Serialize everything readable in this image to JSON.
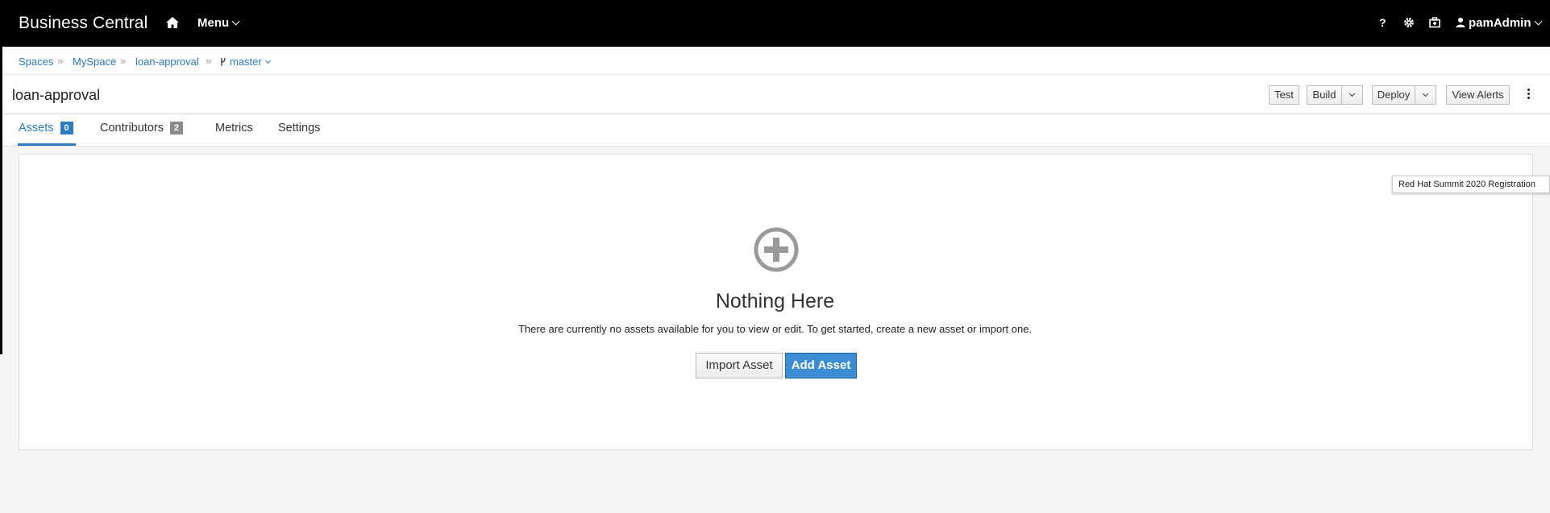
{
  "topbar": {
    "brand": "Business Central",
    "menu_label": "Menu",
    "help_label": "?",
    "user_label": "pamAdmin"
  },
  "breadcrumb": {
    "items": [
      "Spaces",
      "MySpace",
      "loan-approval"
    ],
    "branch": "master",
    "separator": "»"
  },
  "header": {
    "title": "loan-approval",
    "buttons": {
      "test": "Test",
      "build": "Build",
      "deploy": "Deploy",
      "view_alerts": "View Alerts"
    }
  },
  "tabs": [
    {
      "label": "Assets",
      "badge": "0",
      "active": true
    },
    {
      "label": "Contributors",
      "badge": "2",
      "active": false
    },
    {
      "label": "Metrics",
      "active": false
    },
    {
      "label": "Settings",
      "active": false
    }
  ],
  "empty_state": {
    "title": "Nothing Here",
    "text": "There are currently no assets available for you to view or edit. To get started, create a new asset or import one.",
    "import_label": "Import Asset",
    "add_label": "Add Asset"
  },
  "tooltip": "Red Hat Summit 2020 Registration",
  "icons": {
    "home": "home-icon",
    "settings": "gear-icon",
    "case": "briefcase-icon",
    "user": "user-icon",
    "branch": "branch-icon",
    "add": "plus-circle-icon",
    "more": "kebab-icon"
  },
  "colors": {
    "topbar": "#000000",
    "link": "#2b7bc2",
    "primary_button": "#3c8dd4",
    "badge_grey": "#8a8a8a"
  }
}
